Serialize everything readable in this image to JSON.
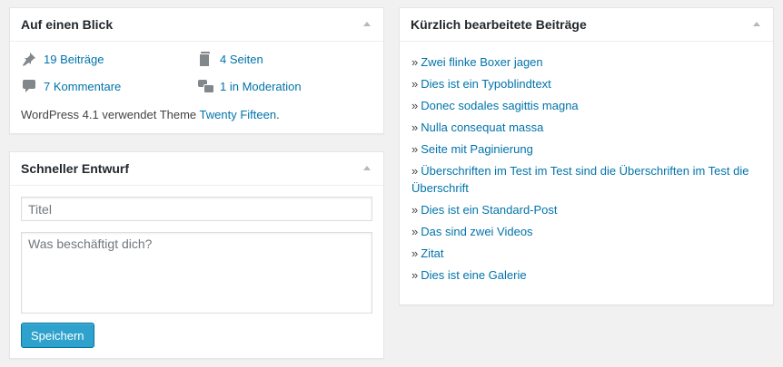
{
  "glance": {
    "title": "Auf einen Blick",
    "items": [
      {
        "label": "19 Beiträge",
        "icon": "pin-icon"
      },
      {
        "label": "4 Seiten",
        "icon": "pages-icon"
      },
      {
        "label": "7 Kommentare",
        "icon": "comment-icon"
      },
      {
        "label": "1 in Moderation",
        "icon": "comments-moderation-icon"
      }
    ],
    "footer_prefix": "WordPress 4.1 verwendet Theme ",
    "theme_link": "Twenty Fifteen",
    "footer_suffix": "."
  },
  "draft": {
    "title": "Schneller Entwurf",
    "title_placeholder": "Titel",
    "content_placeholder": "Was beschäftigt dich?",
    "save_label": "Speichern"
  },
  "recent": {
    "title": "Kürzlich bearbeitete Beiträge",
    "bullet": "»",
    "posts": [
      "Zwei flinke Boxer jagen",
      "Dies ist ein Typoblindtext",
      "Donec sodales sagittis magna",
      "Nulla consequat massa",
      "Seite mit Paginierung",
      "Überschriften im Test im Test sind die Überschriften im Test die Überschrift",
      "Dies ist ein Standard-Post",
      "Das sind zwei Videos",
      "Zitat",
      "Dies ist eine Galerie"
    ]
  },
  "colors": {
    "link": "#0073aa",
    "button": "#2ea2cc",
    "background": "#f1f1f1"
  }
}
